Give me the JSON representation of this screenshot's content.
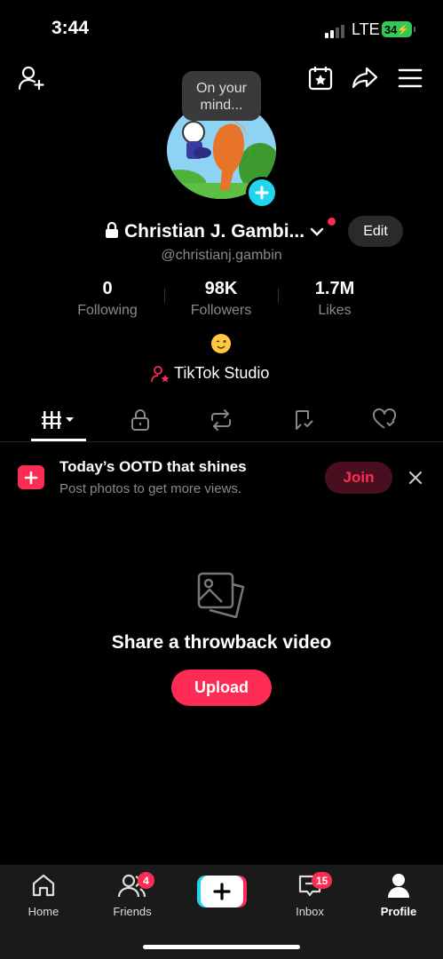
{
  "status_bar": {
    "time": "3:44",
    "network": "LTE",
    "battery": "34"
  },
  "header": {
    "tooltip": "On your mind...",
    "icons": [
      "add-friend-icon",
      "creator-calendar-icon",
      "share-icon",
      "menu-icon"
    ]
  },
  "profile": {
    "display_name": "Christian J. Gambi...",
    "handle": "@christianj.gambin",
    "edit_label": "Edit",
    "stats": [
      {
        "value": "0",
        "label": "Following"
      },
      {
        "value": "98K",
        "label": "Followers"
      },
      {
        "value": "1.7M",
        "label": "Likes"
      }
    ],
    "bio_emoji": "😉",
    "studio_label": "TikTok Studio"
  },
  "tabs": [
    "videos-grid-icon",
    "private-lock-icon",
    "reposts-icon",
    "favorites-icon",
    "liked-icon"
  ],
  "promo": {
    "title": "Today’s OOTD that shines",
    "subtitle": "Post photos to get more views.",
    "join_label": "Join"
  },
  "empty_state": {
    "title": "Share a throwback video",
    "upload_label": "Upload"
  },
  "bottom_nav": {
    "home": "Home",
    "friends": "Friends",
    "friends_badge": "4",
    "inbox": "Inbox",
    "inbox_badge": "15",
    "profile": "Profile"
  },
  "colors": {
    "accent": "#fe2c55",
    "cyan": "#20d5ec",
    "background": "#000000"
  }
}
